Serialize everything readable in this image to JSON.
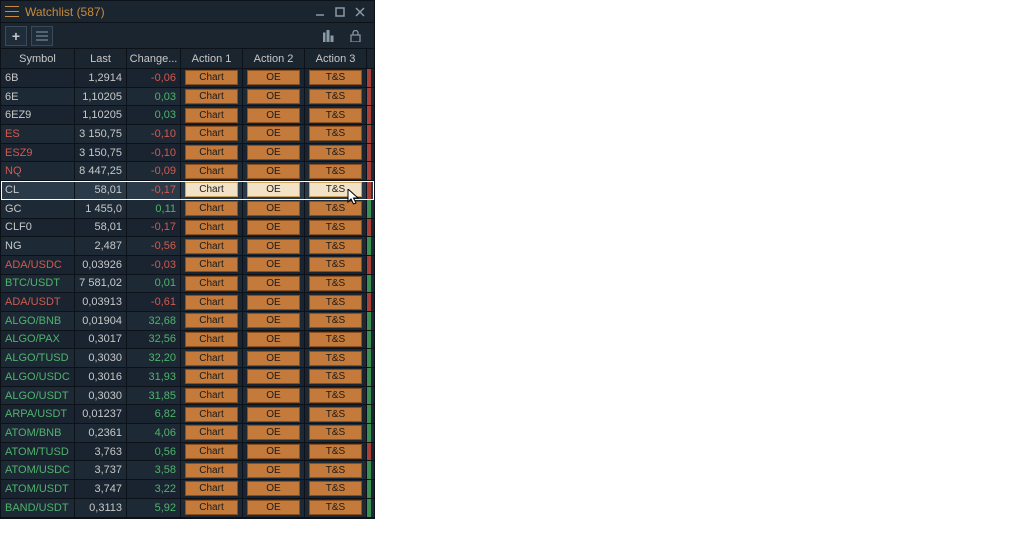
{
  "window": {
    "title": "Watchlist (587)"
  },
  "columns": {
    "symbol": "Symbol",
    "last": "Last",
    "change": "Change...",
    "action1": "Action 1",
    "action2": "Action 2",
    "action3": "Action 3"
  },
  "buttons": {
    "chart": "Chart",
    "oe": "OE",
    "ts": "T&S"
  },
  "rows": [
    {
      "symbol": "6B",
      "sym_dir": "neutral",
      "last": "1,2914",
      "change": "-0,06",
      "chg_dir": "down",
      "ind": "down",
      "selected": false
    },
    {
      "symbol": "6E",
      "sym_dir": "neutral",
      "last": "1,10205",
      "change": "0,03",
      "chg_dir": "up",
      "ind": "down",
      "selected": false
    },
    {
      "symbol": "6EZ9",
      "sym_dir": "neutral",
      "last": "1,10205",
      "change": "0,03",
      "chg_dir": "up",
      "ind": "down",
      "selected": false
    },
    {
      "symbol": "ES",
      "sym_dir": "down",
      "last": "3 150,75",
      "change": "-0,10",
      "chg_dir": "down",
      "ind": "down",
      "selected": false
    },
    {
      "symbol": "ESZ9",
      "sym_dir": "down",
      "last": "3 150,75",
      "change": "-0,10",
      "chg_dir": "down",
      "ind": "down",
      "selected": false
    },
    {
      "symbol": "NQ",
      "sym_dir": "down",
      "last": "8 447,25",
      "change": "-0,09",
      "chg_dir": "down",
      "ind": "down",
      "selected": false
    },
    {
      "symbol": "CL",
      "sym_dir": "neutral",
      "last": "58,01",
      "change": "-0,17",
      "chg_dir": "down",
      "ind": "down",
      "selected": true
    },
    {
      "symbol": "GC",
      "sym_dir": "neutral",
      "last": "1 455,0",
      "change": "0,11",
      "chg_dir": "up",
      "ind": "up",
      "selected": false
    },
    {
      "symbol": "CLF0",
      "sym_dir": "neutral",
      "last": "58,01",
      "change": "-0,17",
      "chg_dir": "down",
      "ind": "down",
      "selected": false
    },
    {
      "symbol": "NG",
      "sym_dir": "neutral",
      "last": "2,487",
      "change": "-0,56",
      "chg_dir": "down",
      "ind": "up",
      "selected": false
    },
    {
      "symbol": "ADA/USDC",
      "sym_dir": "down",
      "last": "0,03926",
      "change": "-0,03",
      "chg_dir": "down",
      "ind": "down",
      "selected": false
    },
    {
      "symbol": "BTC/USDT",
      "sym_dir": "up",
      "last": "7 581,02",
      "change": "0,01",
      "chg_dir": "up",
      "ind": "up",
      "selected": false
    },
    {
      "symbol": "ADA/USDT",
      "sym_dir": "down",
      "last": "0,03913",
      "change": "-0,61",
      "chg_dir": "down",
      "ind": "down",
      "selected": false
    },
    {
      "symbol": "ALGO/BNB",
      "sym_dir": "up",
      "last": "0,01904",
      "change": "32,68",
      "chg_dir": "up",
      "ind": "up",
      "selected": false
    },
    {
      "symbol": "ALGO/PAX",
      "sym_dir": "up",
      "last": "0,3017",
      "change": "32,56",
      "chg_dir": "up",
      "ind": "up",
      "selected": false
    },
    {
      "symbol": "ALGO/TUSD",
      "sym_dir": "up",
      "last": "0,3030",
      "change": "32,20",
      "chg_dir": "up",
      "ind": "up",
      "selected": false
    },
    {
      "symbol": "ALGO/USDC",
      "sym_dir": "up",
      "last": "0,3016",
      "change": "31,93",
      "chg_dir": "up",
      "ind": "up",
      "selected": false
    },
    {
      "symbol": "ALGO/USDT",
      "sym_dir": "up",
      "last": "0,3030",
      "change": "31,85",
      "chg_dir": "up",
      "ind": "up",
      "selected": false
    },
    {
      "symbol": "ARPA/USDT",
      "sym_dir": "up",
      "last": "0,01237",
      "change": "6,82",
      "chg_dir": "up",
      "ind": "up",
      "selected": false
    },
    {
      "symbol": "ATOM/BNB",
      "sym_dir": "up",
      "last": "0,2361",
      "change": "4,06",
      "chg_dir": "up",
      "ind": "up",
      "selected": false
    },
    {
      "symbol": "ATOM/TUSD",
      "sym_dir": "up",
      "last": "3,763",
      "change": "0,56",
      "chg_dir": "up",
      "ind": "down",
      "selected": false
    },
    {
      "symbol": "ATOM/USDC",
      "sym_dir": "up",
      "last": "3,737",
      "change": "3,58",
      "chg_dir": "up",
      "ind": "up",
      "selected": false
    },
    {
      "symbol": "ATOM/USDT",
      "sym_dir": "up",
      "last": "3,747",
      "change": "3,22",
      "chg_dir": "up",
      "ind": "up",
      "selected": false
    },
    {
      "symbol": "BAND/USDT",
      "sym_dir": "up",
      "last": "0,3113",
      "change": "5,92",
      "chg_dir": "up",
      "ind": "up",
      "selected": false
    }
  ]
}
